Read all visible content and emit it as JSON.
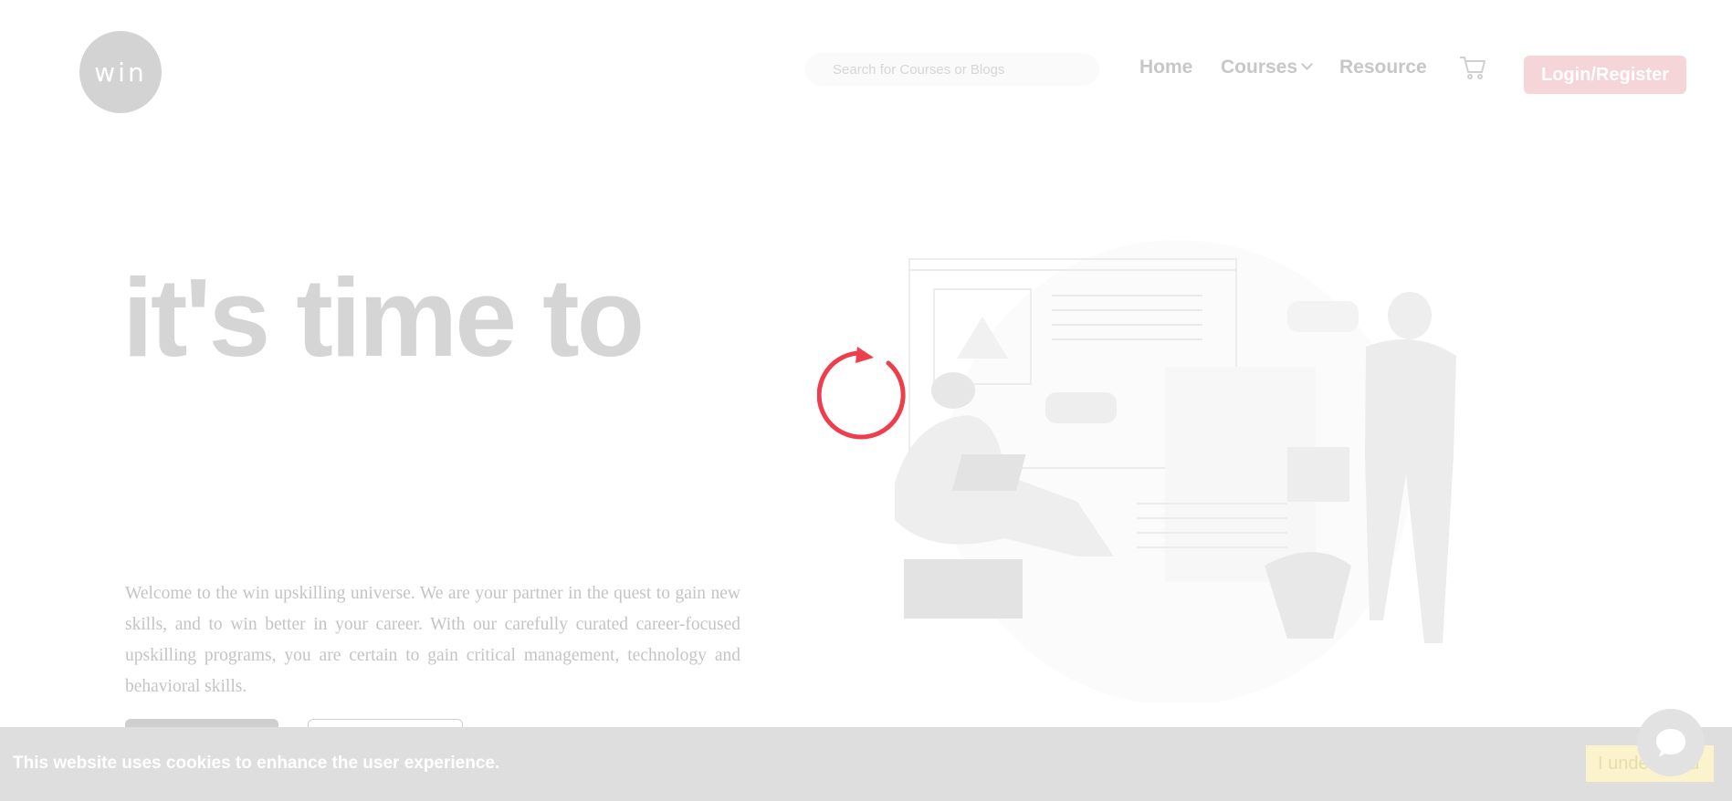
{
  "header": {
    "logo_text": "win",
    "search_placeholder": "Search for Courses or Blogs",
    "nav": {
      "home": "Home",
      "courses": "Courses",
      "resource": "Resource"
    },
    "cart_icon": "cart-icon",
    "login_label": "Login/Register"
  },
  "hero": {
    "title": "it's time to",
    "description": "Welcome to the win upskilling universe. We are your partner in the quest to gain new skills, and to win better in your career. With our carefully curated career-focused upskilling programs, you are certain to gain critical management, technology and behavioral skills."
  },
  "cookie_bar": {
    "message": "This website uses cookies to enhance the user experience.",
    "button_label": "I understand"
  },
  "colors": {
    "accent": "#ef3d4c",
    "muted_text": "#c7c7c7",
    "cookie_bg": "#dedede"
  }
}
